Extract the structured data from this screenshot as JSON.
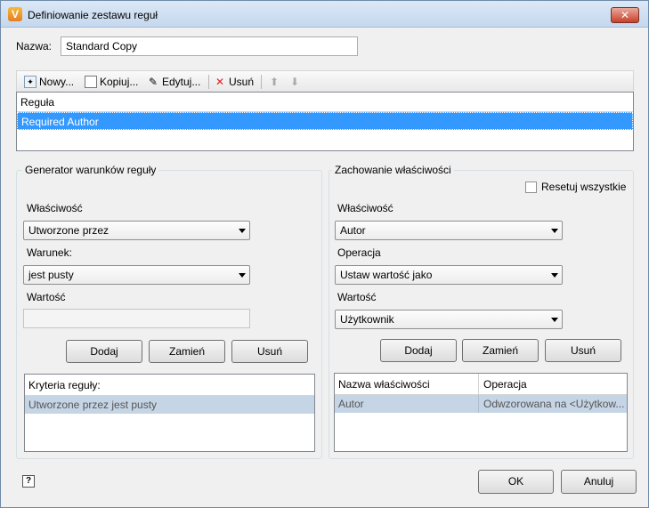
{
  "window": {
    "title": "Definiowanie zestawu reguł",
    "app_icon": "V",
    "close": "✕"
  },
  "name": {
    "label": "Nazwa:",
    "value": "Standard Copy"
  },
  "toolbar": {
    "new_label": "Nowy...",
    "copy_label": "Kopiuj...",
    "edit_label": "Edytuj...",
    "delete_label": "Usuń"
  },
  "rules": {
    "header": "Reguła",
    "items": [
      "Required Author"
    ]
  },
  "conditions": {
    "title": "Generator warunków reguły",
    "property_label": "Właściwość",
    "property_value": "Utworzone przez",
    "condition_label": "Warunek:",
    "condition_value": "jest pusty",
    "value_label": "Wartość",
    "add_label": "Dodaj",
    "replace_label": "Zamień",
    "remove_label": "Usuń",
    "criteria_header": "Kryteria reguły:",
    "criteria_items": [
      "Utworzone przez jest pusty"
    ]
  },
  "behavior": {
    "title": "Zachowanie właściwości",
    "reset_label": "Resetuj wszystkie",
    "property_label": "Właściwość",
    "property_value": "Autor",
    "operation_label": "Operacja",
    "operation_value": "Ustaw wartość jako",
    "value_label": "Wartość",
    "value_value": "Użytkownik",
    "add_label": "Dodaj",
    "replace_label": "Zamień",
    "remove_label": "Usuń",
    "grid_headers": [
      "Nazwa właściwości",
      "Operacja"
    ],
    "grid_rows": [
      [
        "Autor",
        "Odwzorowana na <Użytkow..."
      ]
    ]
  },
  "footer": {
    "help": "?",
    "ok_label": "OK",
    "cancel_label": "Anuluj"
  }
}
